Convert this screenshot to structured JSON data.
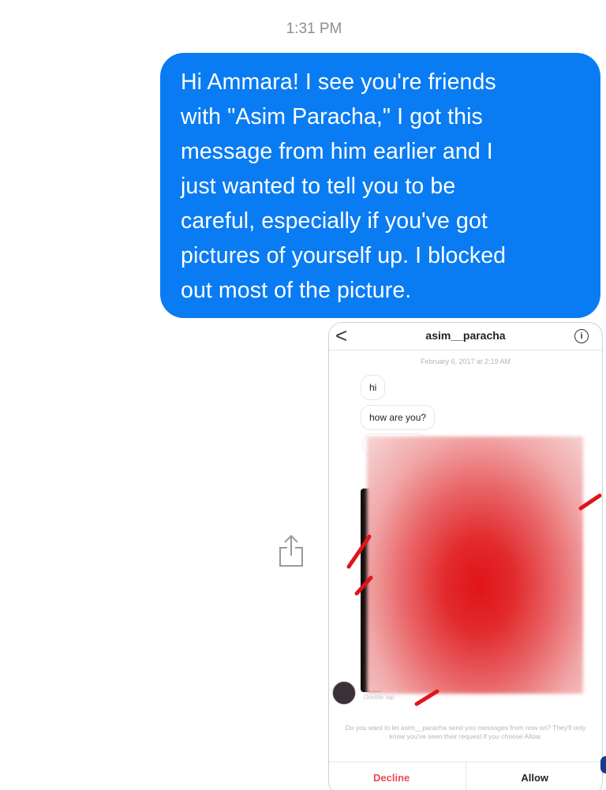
{
  "conversation": {
    "timestamp": "1:31 PM",
    "message_lines": [
      "Hi Ammara! I see you're friends",
      "with \"Asim Paracha,\" I got this",
      "message from him earlier and I",
      "just wanted to tell you to be",
      "careful, especially if you've got",
      "pictures of yourself up. I blocked",
      "out most of the picture."
    ],
    "share_icon": "share-icon"
  },
  "attachment": {
    "header": {
      "back_glyph": "<",
      "username": "asim__paracha",
      "info_glyph": "i"
    },
    "date": "February 6, 2017 at 2:19 AM",
    "messages": [
      "hi",
      "how are you?"
    ],
    "double_tap": "Double tap",
    "prompt": "Do you want to let asim__paracha send you messages from now on? They'll only know you've seen their request if you choose Allow.",
    "buttons": {
      "decline": "Decline",
      "allow": "Allow"
    },
    "colors": {
      "decline": "#ed4956",
      "redaction": "#e0141a"
    }
  },
  "colors": {
    "bubble": "#0a7cf3",
    "timestamp": "#8e8e93"
  }
}
